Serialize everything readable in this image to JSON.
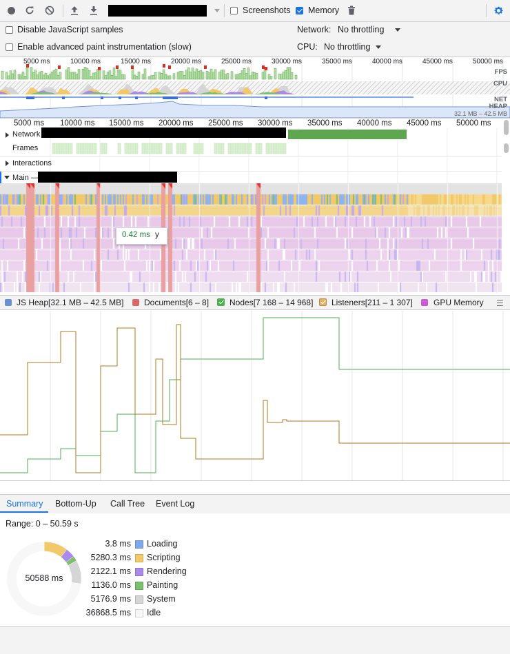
{
  "toolbar": {
    "screenshots_label": "Screenshots",
    "screenshots_checked": false,
    "memory_label": "Memory",
    "memory_checked": true
  },
  "settings": {
    "disable_js_samples": "Disable JavaScript samples",
    "advanced_paint": "Enable advanced paint instrumentation (slow)",
    "network_label": "Network:",
    "network_value": "No throttling",
    "cpu_label": "CPU:",
    "cpu_value": "No throttling"
  },
  "overview": {
    "ticks": [
      "5000 ms",
      "10000 ms",
      "15000 ms",
      "20000 ms",
      "25000 ms",
      "30000 ms",
      "35000 ms",
      "40000 ms",
      "45000 ms",
      "50000 ms"
    ],
    "fps_label": "FPS",
    "cpu_label": "CPU",
    "net_label": "NET",
    "heap_label": "HEAP",
    "heap_range": "32.1 MB – 42.5 MB"
  },
  "ruler": {
    "ticks": [
      "5000 ms",
      "10000 ms",
      "15000 ms",
      "20000 ms",
      "25000 ms",
      "30000 ms",
      "35000 ms",
      "40000 ms",
      "45000 ms",
      "50000 ms"
    ]
  },
  "tracks": {
    "network": "Network",
    "frames": "Frames",
    "interactions": "Interactions",
    "main": "Main —"
  },
  "tooltip": {
    "duration": "0.42 ms",
    "name": "y"
  },
  "legend": {
    "items": [
      {
        "label": "JS Heap[32.1 MB – 42.5 MB]",
        "color": "#6b8fd6",
        "checked": true
      },
      {
        "label": "Documents[6 – 8]",
        "color": "#d9686a",
        "checked": true
      },
      {
        "label": "Nodes[7 168 – 14 968]",
        "color": "#4caf50",
        "checked": true
      },
      {
        "label": "Listeners[211 – 1 307]",
        "color": "#c08a3a",
        "checked": true
      },
      {
        "label": "GPU Memory",
        "color": "#c95cd4",
        "checked": true
      }
    ]
  },
  "bottom_tabs": [
    "Summary",
    "Bottom-Up",
    "Call Tree",
    "Event Log"
  ],
  "summary": {
    "range": "Range: 0 – 50.59 s",
    "total": "50588 ms",
    "rows": [
      {
        "value": "3.8 ms",
        "name": "Loading",
        "color": "#7ea8e6"
      },
      {
        "value": "5280.3 ms",
        "name": "Scripting",
        "color": "#f2c96a"
      },
      {
        "value": "2122.1 ms",
        "name": "Rendering",
        "color": "#a98ae8"
      },
      {
        "value": "1136.0 ms",
        "name": "Painting",
        "color": "#7cbf6e"
      },
      {
        "value": "5176.9 ms",
        "name": "System",
        "color": "#d5d5d5"
      },
      {
        "value": "36868.5 ms",
        "name": "Idle",
        "color": "#f7f7f7"
      }
    ]
  },
  "colors": {
    "accent": "#1a73e8",
    "nodes_line": "#4caf50",
    "listeners_line": "#b07a1e"
  }
}
